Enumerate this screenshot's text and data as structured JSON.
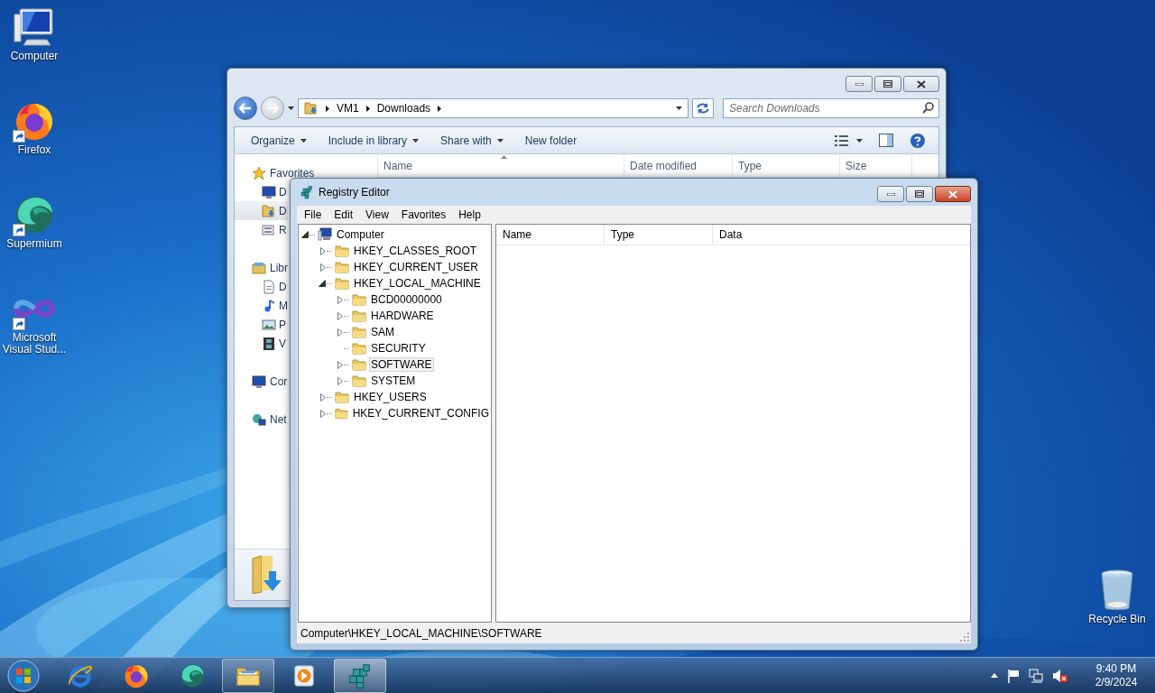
{
  "desktop_icons": [
    {
      "label": "Computer",
      "kind": "computer",
      "shortcut": false
    },
    {
      "label": "Firefox",
      "kind": "firefox",
      "shortcut": true
    },
    {
      "label": "Supermium",
      "kind": "supermium",
      "shortcut": true
    },
    {
      "label": "Microsoft Visual Stud...",
      "kind": "visual_studio",
      "shortcut": true
    }
  ],
  "recycle_bin": {
    "label": "Recycle Bin"
  },
  "explorer": {
    "address": [
      "VM1",
      "Downloads"
    ],
    "search": {
      "placeholder": "Search Downloads"
    },
    "toolbar": [
      {
        "label": "Organize",
        "dropdown": true
      },
      {
        "label": "Include in library",
        "dropdown": true
      },
      {
        "label": "Share with",
        "dropdown": true
      },
      {
        "label": "New folder",
        "dropdown": false
      }
    ],
    "columns": [
      {
        "label": "Name",
        "sorted": true
      },
      {
        "label": "Date modified",
        "sorted": false
      },
      {
        "label": "Type",
        "sorted": false
      },
      {
        "label": "Size",
        "sorted": false
      }
    ],
    "nav": [
      {
        "label": "Favorites",
        "kind": "favorites",
        "selected": false,
        "children": [
          {
            "label": "D",
            "kind": "desktop",
            "selected": false
          },
          {
            "label": "D",
            "kind": "downloads",
            "selected": true
          },
          {
            "label": "R",
            "kind": "recent",
            "selected": false
          }
        ]
      },
      {
        "label": "Libr",
        "kind": "libraries",
        "selected": false,
        "children": [
          {
            "label": "D",
            "kind": "documents",
            "selected": false
          },
          {
            "label": "M",
            "kind": "music",
            "selected": false
          },
          {
            "label": "P",
            "kind": "pictures",
            "selected": false
          },
          {
            "label": "V",
            "kind": "videos",
            "selected": false
          }
        ]
      },
      {
        "label": "Cor",
        "kind": "computer",
        "selected": false
      },
      {
        "label": "Net",
        "kind": "network",
        "selected": false
      }
    ]
  },
  "regedit": {
    "title": "Registry Editor",
    "menu": [
      "File",
      "Edit",
      "View",
      "Favorites",
      "Help"
    ],
    "tree": [
      {
        "label": "Computer",
        "expandable": true,
        "expanded": true,
        "selected": false,
        "children": [
          {
            "label": "HKEY_CLASSES_ROOT",
            "expandable": true,
            "expanded": false,
            "selected": false
          },
          {
            "label": "HKEY_CURRENT_USER",
            "expandable": true,
            "expanded": false,
            "selected": false
          },
          {
            "label": "HKEY_LOCAL_MACHINE",
            "expandable": true,
            "expanded": true,
            "selected": false,
            "children": [
              {
                "label": "BCD00000000",
                "expandable": true,
                "selected": false
              },
              {
                "label": "HARDWARE",
                "expandable": true,
                "selected": false
              },
              {
                "label": "SAM",
                "expandable": true,
                "selected": false
              },
              {
                "label": "SECURITY",
                "expandable": false,
                "selected": false
              },
              {
                "label": "SOFTWARE",
                "expandable": true,
                "selected": true
              },
              {
                "label": "SYSTEM",
                "expandable": true,
                "selected": false
              }
            ]
          },
          {
            "label": "HKEY_USERS",
            "expandable": true,
            "expanded": false,
            "selected": false
          },
          {
            "label": "HKEY_CURRENT_CONFIG",
            "expandable": true,
            "expanded": false,
            "selected": false
          }
        ]
      }
    ],
    "columns": [
      "Name",
      "Type",
      "Data"
    ],
    "status_bar": "Computer\\HKEY_LOCAL_MACHINE\\SOFTWARE"
  },
  "taskbar": {
    "items": [
      {
        "kind": "ie",
        "open": false,
        "active": false
      },
      {
        "kind": "firefox",
        "open": false,
        "active": false
      },
      {
        "kind": "supermium",
        "open": false,
        "active": false
      },
      {
        "kind": "explorer",
        "open": true,
        "active": false
      },
      {
        "kind": "media",
        "open": false,
        "active": false
      },
      {
        "kind": "regedit",
        "open": true,
        "active": true
      }
    ],
    "clock": {
      "time": "9:40 PM",
      "date": "2/9/2024"
    }
  }
}
